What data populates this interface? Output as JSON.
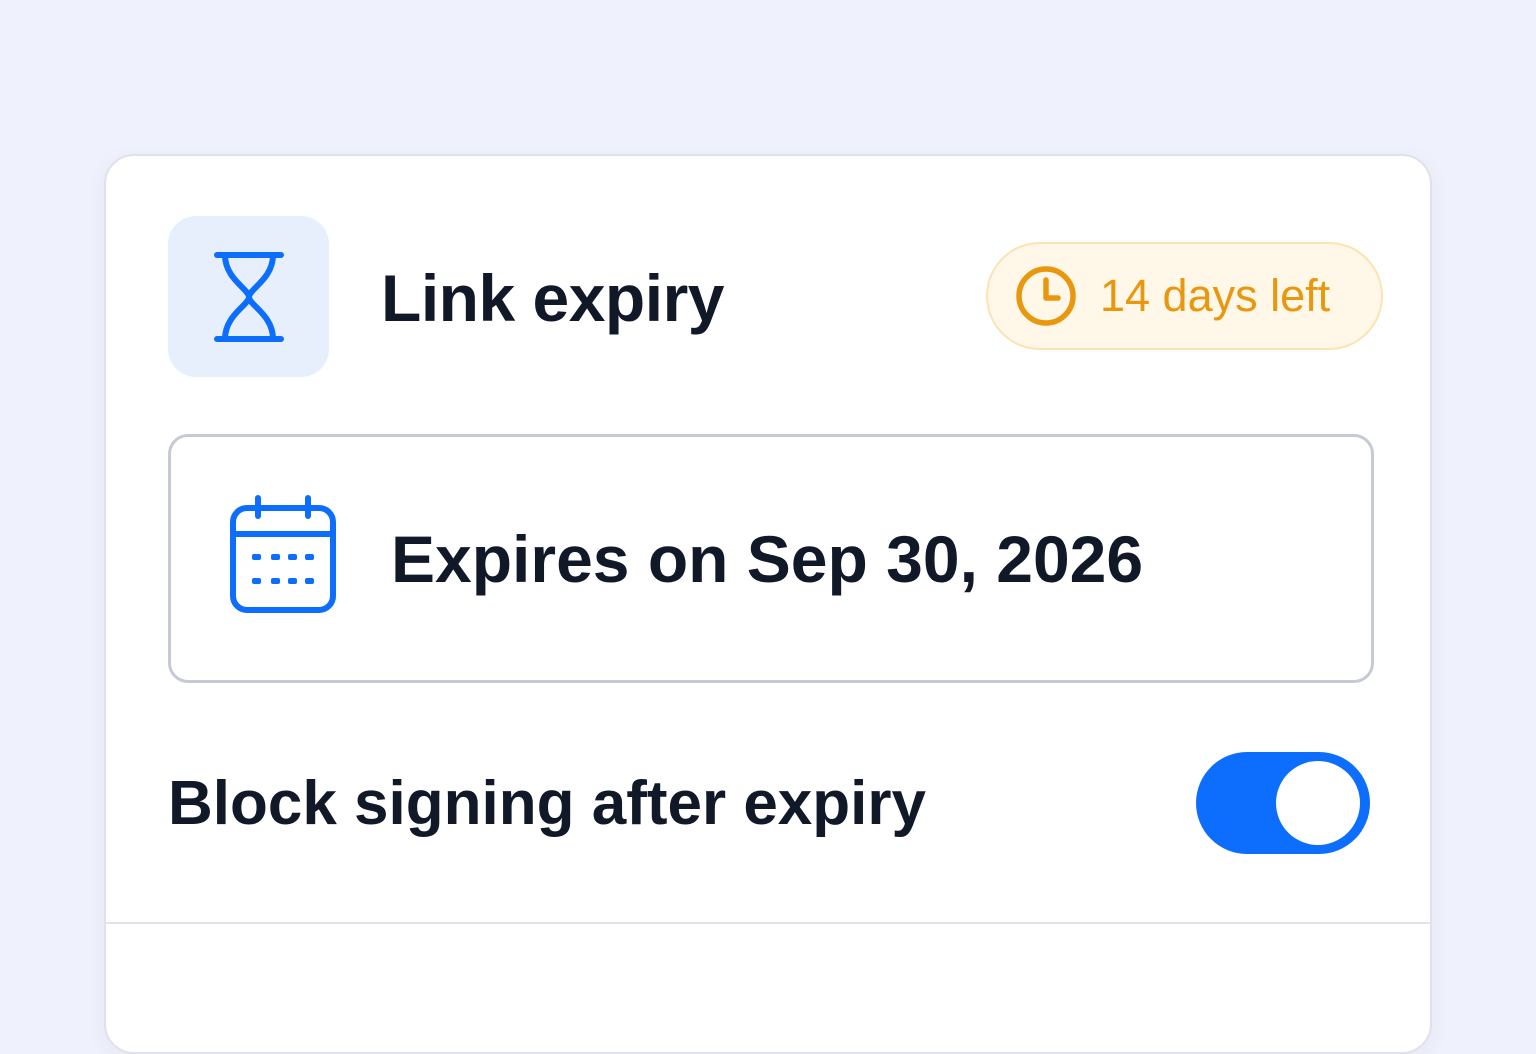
{
  "card": {
    "title": "Link expiry",
    "header_icon": "hourglass-icon",
    "badge": {
      "icon": "clock-icon",
      "text": "14 days left"
    },
    "date_field": {
      "icon": "calendar-icon",
      "text": "Expires on Sep 30, 2026"
    },
    "block_signing": {
      "label": "Block signing after expiry",
      "enabled": true
    }
  },
  "colors": {
    "accent": "#0d6efd",
    "warning": "#e8970f",
    "warning_bg": "#fff7e8",
    "icon_tile_bg": "#e7effd",
    "text": "#111827",
    "page_bg": "#eff2fc"
  }
}
